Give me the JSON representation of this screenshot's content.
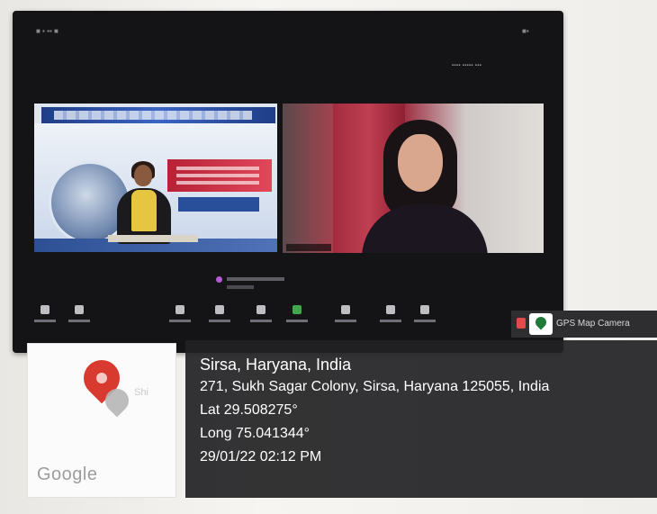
{
  "location": {
    "city": "Sirsa, Haryana, India",
    "address": "271, Sukh Sagar Colony, Sirsa, Haryana 125055, India",
    "lat": "Lat 29.508275°",
    "long": "Long 75.041344°",
    "datetime": "29/01/22 02:12 PM"
  },
  "gps_badge": {
    "label": "GPS Map Camera"
  },
  "map_thumbnail": {
    "brand": "Google",
    "partial_label": "Shi"
  },
  "icons": [
    "map-pin-icon",
    "gps-camera-app-icon",
    "microphone-icon",
    "video-icon",
    "security-icon",
    "participants-icon",
    "chat-icon",
    "share-screen-icon",
    "record-icon",
    "reactions-icon",
    "apps-icon"
  ],
  "colors": {
    "overlay_bg": "#222224",
    "pin_red": "#d93a2f",
    "share_green": "#3ea84a"
  }
}
